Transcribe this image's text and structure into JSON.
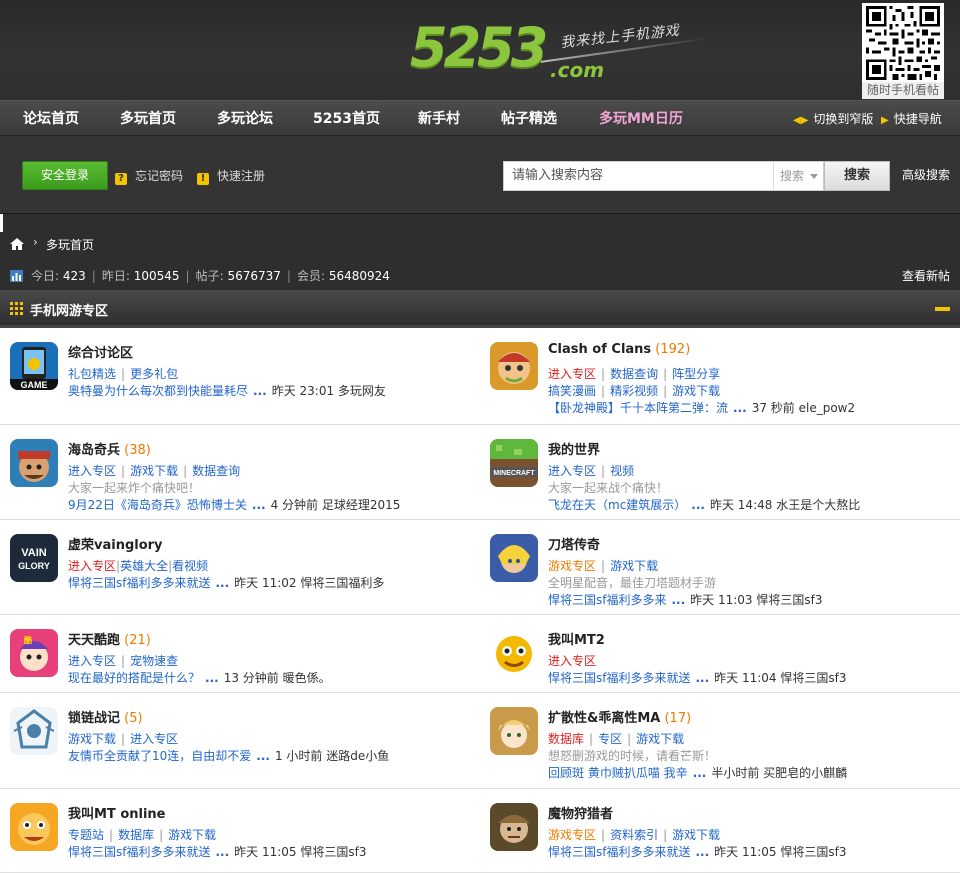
{
  "header": {
    "logo_number": "5253",
    "logo_domain": ".com",
    "logo_slogan": "我来找上手机游戏",
    "qr_caption": "随时手机看帖"
  },
  "nav": {
    "items": [
      "论坛首页",
      "多玩首页",
      "多玩论坛",
      "5253首页",
      "新手村",
      "帖子精选",
      "多玩MM日历"
    ],
    "switch_label": "切换到窄版",
    "quick_nav_label": "快捷导航"
  },
  "login": {
    "login_button": "安全登录",
    "forgot_password": "忘记密码",
    "quick_register": "快速注册",
    "search_placeholder": "请输入搜索内容",
    "search_type": "搜索",
    "search_button": "搜索",
    "advanced_search": "高级搜索"
  },
  "breadcrumb": {
    "current": "多玩首页"
  },
  "stats": {
    "today_label": "今日:",
    "today": "423",
    "yesterday_label": "昨日:",
    "yesterday": "100545",
    "posts_label": "帖子:",
    "posts": "5676737",
    "members_label": "会员:",
    "members": "56480924",
    "new_posts": "查看新帖"
  },
  "section": {
    "title": "手机网游专区"
  },
  "forums": [
    {
      "name": "综合讨论区",
      "count": "",
      "links": [
        {
          "text": "礼包精选",
          "color": "blue"
        },
        {
          "text": "更多礼包",
          "color": "blue"
        }
      ],
      "desc": "",
      "last_title": "奥特曼为什么每次都到快能量耗尽",
      "last_time": "昨天 23:01",
      "last_user": "多玩网友",
      "icon": "game-phone-icon"
    },
    {
      "name": "Clash of Clans",
      "count": "(192)",
      "links": [
        {
          "text": "进入专区",
          "color": "red"
        },
        {
          "text": "数据查询",
          "color": "blue"
        },
        {
          "text": "阵型分享",
          "color": "blue"
        }
      ],
      "links2": [
        {
          "text": "搞笑漫画",
          "color": "blue"
        },
        {
          "text": "精彩视频",
          "color": "blue"
        },
        {
          "text": "游戏下载",
          "color": "blue"
        }
      ],
      "desc": "",
      "last_title": "【卧龙神殿】千十本阵第二弹：流",
      "last_time": "37 秒前",
      "last_user": "ele_pow2",
      "icon": "clash-of-clans-icon"
    },
    {
      "name": "海岛奇兵",
      "count": "(38)",
      "links": [
        {
          "text": "进入专区",
          "color": "blue"
        },
        {
          "text": "游戏下载",
          "color": "blue"
        },
        {
          "text": "数据查询",
          "color": "blue"
        }
      ],
      "desc": "大家一起来炸个痛快吧！",
      "last_title": "9月22日《海岛奇兵》恐怖博士关",
      "last_time": "4 分钟前",
      "last_user": "足球经理2015",
      "icon": "boom-beach-icon"
    },
    {
      "name": "我的世界",
      "count": "",
      "links": [
        {
          "text": "进入专区",
          "color": "blue"
        },
        {
          "text": "视频",
          "color": "blue"
        }
      ],
      "desc": "大家一起来战个痛快！",
      "last_title": "飞龙在天（mc建筑展示）",
      "last_time": "昨天 14:48",
      "last_user": "水王是个大熬比",
      "icon": "minecraft-icon"
    },
    {
      "name": "虚荣vainglory",
      "count": "",
      "links_inline": [
        {
          "text": "进入专区",
          "color": "red"
        },
        {
          "text": "英雄大全",
          "color": "blue"
        },
        {
          "text": "看视频",
          "color": "blue"
        }
      ],
      "desc": "",
      "last_title": "悍将三国sf福利多多来就送",
      "last_time": "昨天 11:02",
      "last_user": "悍将三国福利多",
      "icon": "vainglory-icon"
    },
    {
      "name": "刀塔传奇",
      "count": "",
      "links": [
        {
          "text": "游戏专区",
          "color": "orange"
        },
        {
          "text": "游戏下载",
          "color": "blue"
        }
      ],
      "desc": "全明星配音，最佳刀塔题材手游",
      "last_title": "悍将三国sf福利多多来",
      "last_time": "昨天 11:03",
      "last_user": "悍将三国sf3",
      "icon": "dota-legend-icon"
    },
    {
      "name": "天天酷跑",
      "count": "(21)",
      "links": [
        {
          "text": "进入专区",
          "color": "blue"
        },
        {
          "text": "宠物速查",
          "color": "blue"
        }
      ],
      "desc": "",
      "last_title": "现在最好的搭配是什么？",
      "last_time": "13 分钟前",
      "last_user": "暖色係。",
      "icon": "parkour-icon"
    },
    {
      "name": "我叫MT2",
      "count": "",
      "links": [
        {
          "text": "进入专区",
          "color": "red"
        }
      ],
      "desc": "",
      "last_title": "悍将三国sf福利多多来就送",
      "last_time": "昨天 11:04",
      "last_user": "悍将三国sf3",
      "icon": "mt2-icon"
    },
    {
      "name": "锁链战记",
      "count": "(5)",
      "links": [
        {
          "text": "游戏下载",
          "color": "blue"
        },
        {
          "text": "进入专区",
          "color": "blue"
        }
      ],
      "desc": "",
      "last_title": "友情币全贡献了10连，自由却不爱",
      "last_time": "1 小时前",
      "last_user": "迷路de小鱼",
      "icon": "chain-chronicle-icon"
    },
    {
      "name": "扩散性&乖离性MA",
      "count": "(17)",
      "links": [
        {
          "text": "数据库",
          "color": "red"
        },
        {
          "text": "专区",
          "color": "blue"
        },
        {
          "text": "游戏下载",
          "color": "blue"
        }
      ],
      "desc": "想怒删游戏的时候，请看芒斯！",
      "last_title": "回顾斑 黄巾贼扒瓜喵 我辛",
      "last_time": "半小时前",
      "last_user": "买肥皂的小麒麟",
      "icon": "million-arthur-icon"
    },
    {
      "name": "我叫MT online",
      "count": "",
      "links": [
        {
          "text": "专题站",
          "color": "blue"
        },
        {
          "text": "数据库",
          "color": "blue"
        },
        {
          "text": "游戏下载",
          "color": "blue"
        }
      ],
      "desc": "",
      "last_title": "悍将三国sf福利多多来就送",
      "last_time": "昨天 11:05",
      "last_user": "悍将三国sf3",
      "icon": "mt-online-icon"
    },
    {
      "name": "魔物狩猎者",
      "count": "",
      "links": [
        {
          "text": "游戏专区",
          "color": "orange"
        },
        {
          "text": "资料索引",
          "color": "blue"
        },
        {
          "text": "游戏下载",
          "color": "blue"
        }
      ],
      "desc": "",
      "last_title": "悍将三国sf福利多多来就送",
      "last_time": "昨天 11:05",
      "last_user": "悍将三国sf3",
      "icon": "monster-hunter-icon"
    }
  ]
}
